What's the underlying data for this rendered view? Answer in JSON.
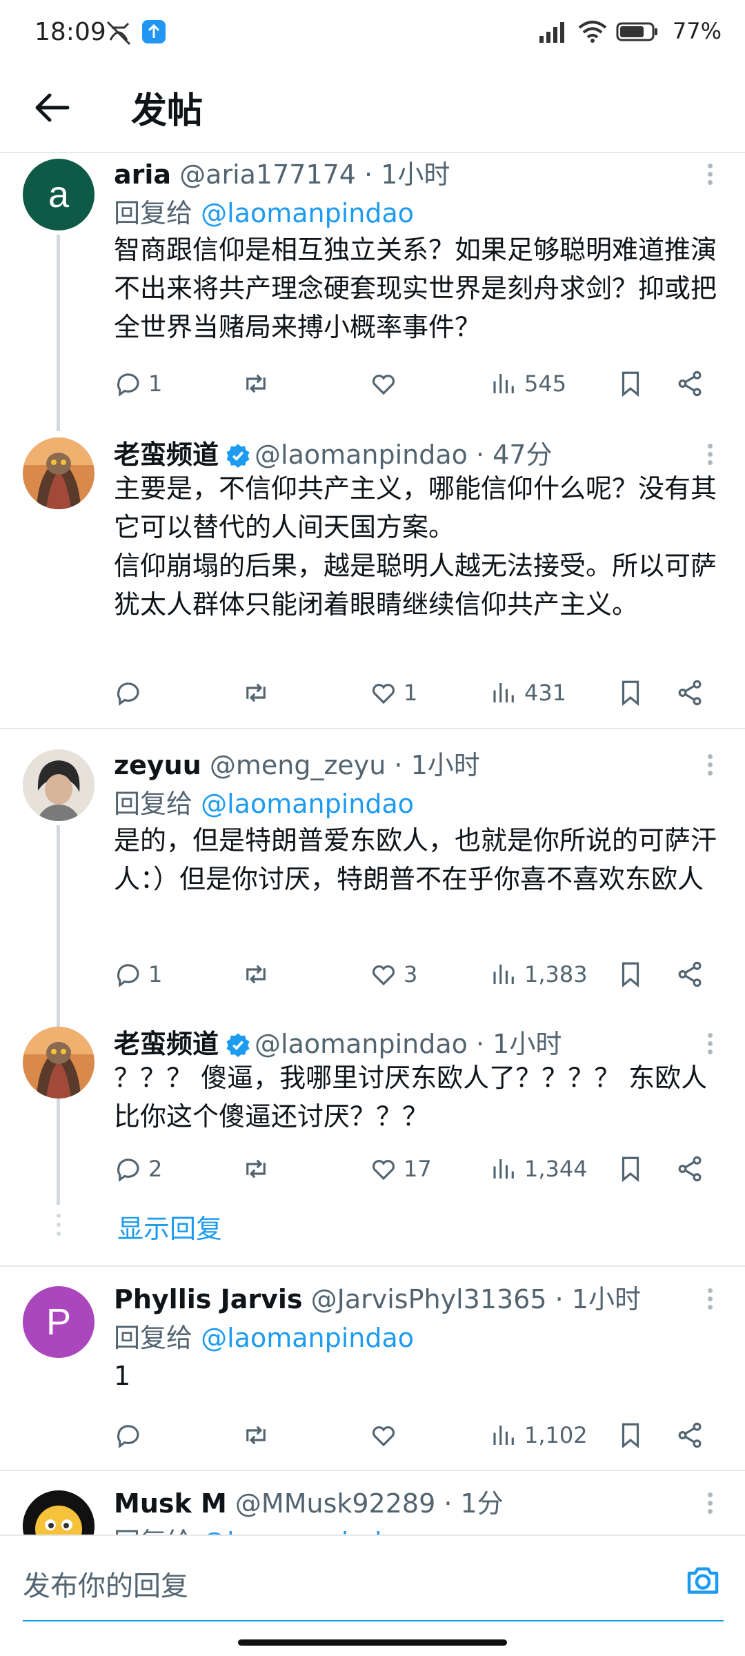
{
  "status_bar": {
    "time": "18:09",
    "battery": "77%"
  },
  "header": {
    "title": "发帖"
  },
  "tweets": [
    {
      "name": "aria",
      "handle": "@aria177174 · 1小时",
      "reply_label": "回复给",
      "reply_to": "@laomanpindao",
      "text": "智商跟信仰是相互独立关系？如果足够聪明难道推演不出来将共产理念硬套现实世界是刻舟求剑？抑或把全世界当赌局来搏小概率事件？",
      "replies": "1",
      "retweets": "",
      "likes": "",
      "views": "545",
      "avatar_letter": "a",
      "avatar_color": "#0e5a47"
    },
    {
      "name": "老蛮频道",
      "handle": "@laomanpindao · 47分",
      "text": "主要是，不信仰共产主义，哪能信仰什么呢？没有其它可以替代的人间天国方案。\n信仰崩塌的后果，越是聪明人越无法接受。所以可萨犹太人群体只能闭着眼睛继续信仰共产主义。",
      "replies": "",
      "retweets": "",
      "likes": "1",
      "views": "431"
    },
    {
      "name": "zeyuu",
      "handle": "@meng_zeyu · 1小时",
      "reply_label": "回复给",
      "reply_to": "@laomanpindao",
      "text": "是的，但是特朗普爱东欧人，也就是你所说的可萨汗人：）但是你讨厌，特朗普不在乎你喜不喜欢东欧人",
      "replies": "1",
      "retweets": "",
      "likes": "3",
      "views": "1,383"
    },
    {
      "name": "老蛮频道",
      "handle": "@laomanpindao · 1小时",
      "text": "？？？ 傻逼，我哪里讨厌东欧人了？？？？ 东欧人比你这个傻逼还讨厌？？？",
      "replies": "2",
      "retweets": "",
      "likes": "17",
      "views": "1,344"
    },
    {
      "name": "Phyllis Jarvis",
      "handle": "@JarvisPhyl31365 · 1小时",
      "reply_label": "回复给",
      "reply_to": "@laomanpindao",
      "text": "1",
      "replies": "",
      "retweets": "",
      "likes": "",
      "views": "1,102",
      "avatar_letter": "P",
      "avatar_color": "#ab47bc"
    },
    {
      "name": "Musk M",
      "handle": "@MMusk92289 · 1分",
      "reply_label": "回复给",
      "reply_to": "@laomanpindao"
    }
  ],
  "show_replies": "显示回复",
  "composer": {
    "placeholder": "发布你的回复"
  },
  "colors": {
    "accent": "#1d9bf0",
    "secondary_text": "#536471",
    "divider": "#e5e7ea"
  }
}
